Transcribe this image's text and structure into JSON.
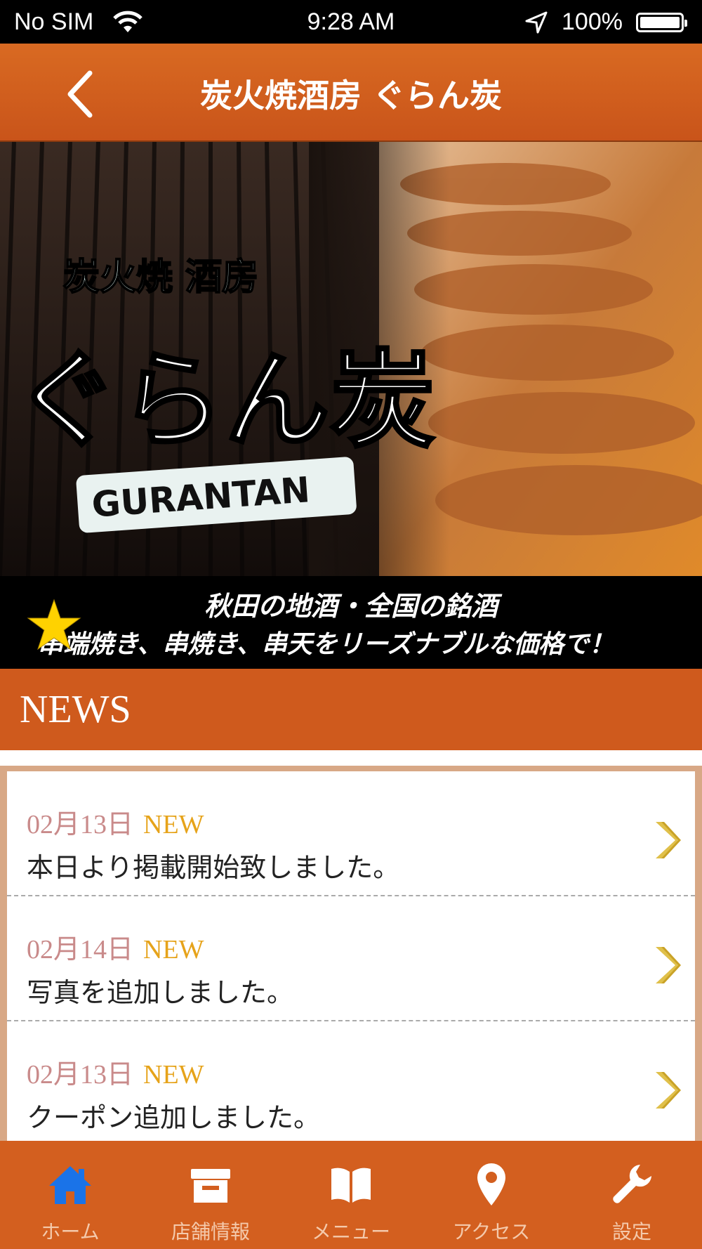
{
  "status_bar": {
    "carrier": "No SIM",
    "time": "9:28 AM",
    "battery": "100%"
  },
  "nav": {
    "title": "炭火焼酒房 ぐらん炭"
  },
  "hero": {
    "logo_small": "炭火焼 酒房",
    "logo_large": "ぐらん炭",
    "logo_roman": "GURANTAN",
    "caption_line1": "秋田の地酒・全国の銘酒",
    "caption_line2": "串端焼き、串焼き、串天をリーズナブルな価格で！"
  },
  "news": {
    "header": "NEWS",
    "items": [
      {
        "date": "02月13日",
        "badge": "NEW",
        "text": "本日より掲載開始致しました。"
      },
      {
        "date": "02月14日",
        "badge": "NEW",
        "text": "写真を追加しました。"
      },
      {
        "date": "02月13日",
        "badge": "NEW",
        "text": "クーポン追加しました。"
      }
    ]
  },
  "tabs": [
    {
      "label": "ホーム",
      "icon": "home-icon"
    },
    {
      "label": "店舗情報",
      "icon": "shop-icon"
    },
    {
      "label": "メニュー",
      "icon": "book-icon"
    },
    {
      "label": "アクセス",
      "icon": "map-pin-icon"
    },
    {
      "label": "設定",
      "icon": "wrench-icon"
    }
  ],
  "colors": {
    "brand": "#cf5a1d",
    "active_tab": "#1a73e8",
    "news_date": "#c98a8a",
    "news_badge": "#e6a31a"
  }
}
